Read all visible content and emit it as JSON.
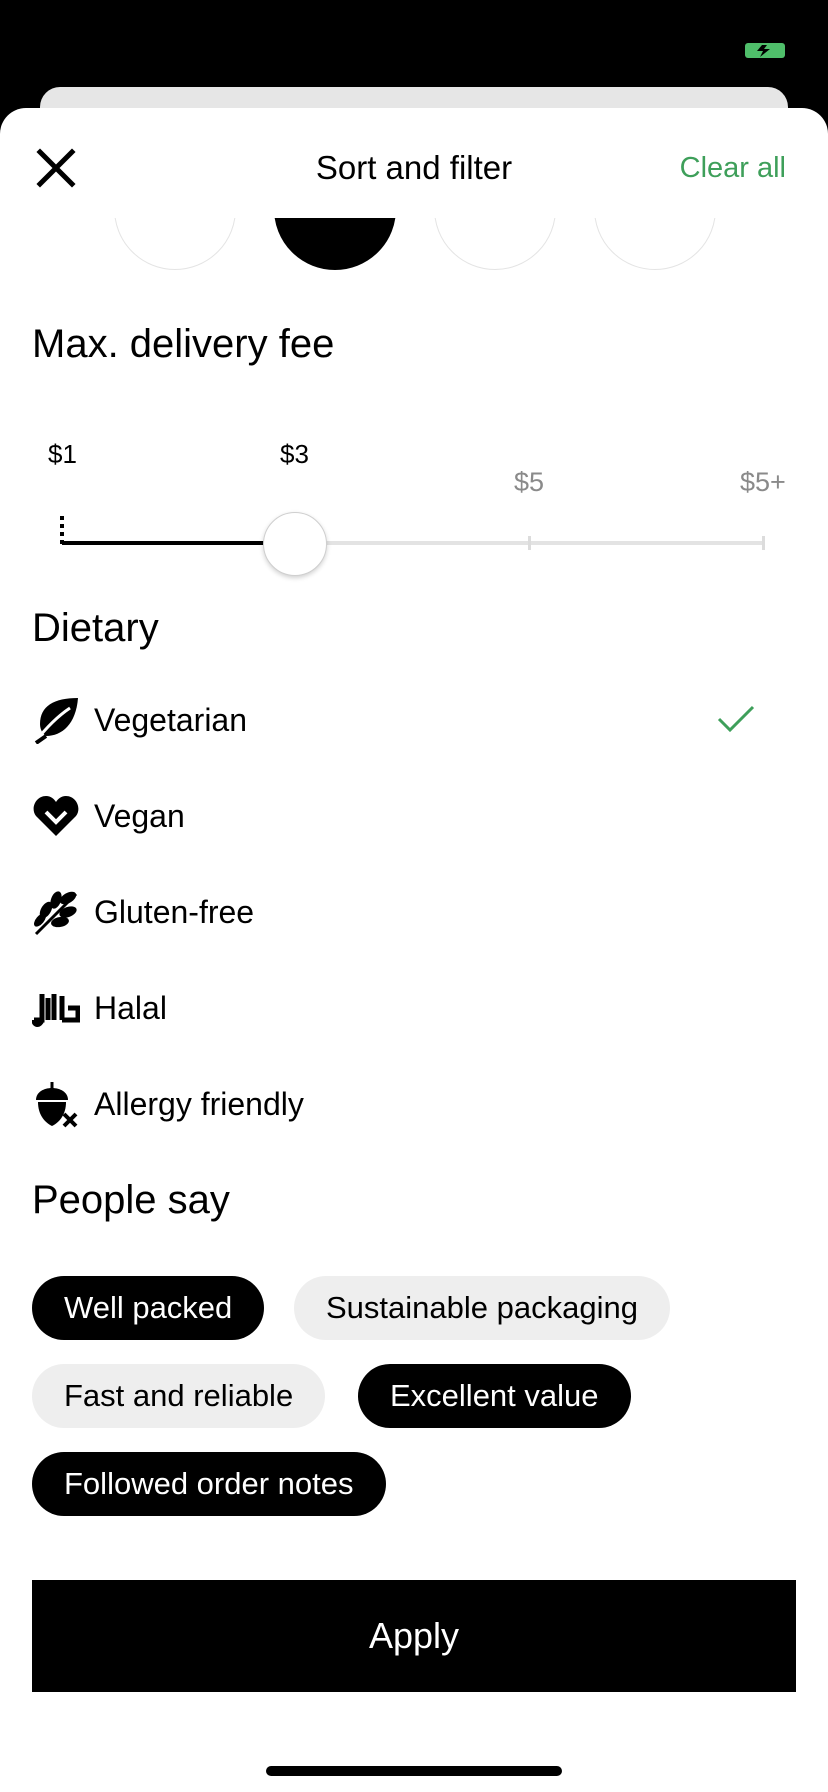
{
  "header": {
    "title": "Sort and filter",
    "clear_label": "Clear all",
    "accent_color": "#3e9f5a"
  },
  "price_range": {
    "selected_index": 1,
    "count": 4
  },
  "delivery_fee": {
    "title": "Max. delivery fee",
    "labels": [
      "$1",
      "$3",
      "$5",
      "$5+"
    ],
    "selected_label": "$3",
    "selected_fraction": 0.33
  },
  "dietary": {
    "title": "Dietary",
    "items": [
      {
        "label": "Vegetarian",
        "icon": "leaf-icon",
        "checked": true
      },
      {
        "label": "Vegan",
        "icon": "heart-icon",
        "checked": false
      },
      {
        "label": "Gluten-free",
        "icon": "wheat-icon",
        "checked": false
      },
      {
        "label": "Halal",
        "icon": "halal-icon",
        "checked": false
      },
      {
        "label": "Allergy friendly",
        "icon": "acorn-x-icon",
        "checked": false
      }
    ]
  },
  "people_say": {
    "title": "People say",
    "chips": [
      {
        "label": "Well packed",
        "active": true
      },
      {
        "label": "Sustainable packaging",
        "active": false
      },
      {
        "label": "Fast and reliable",
        "active": false
      },
      {
        "label": "Excellent value",
        "active": true
      },
      {
        "label": "Followed order notes",
        "active": true
      }
    ]
  },
  "apply_label": "Apply"
}
